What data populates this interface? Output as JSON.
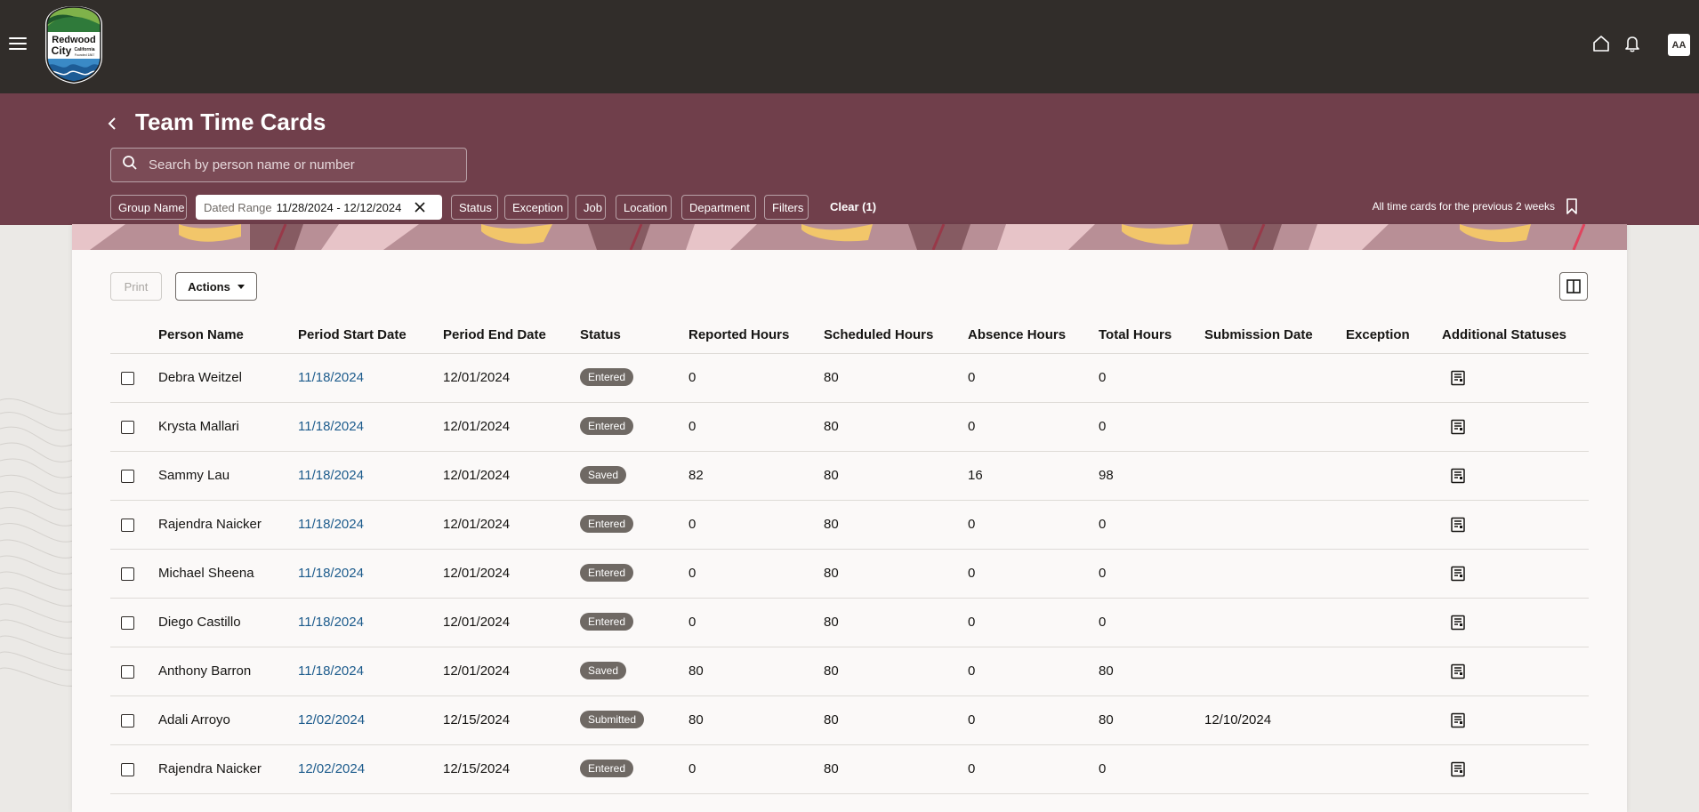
{
  "app": {
    "logo": {
      "line1": "Redwood",
      "line2": "City",
      "line3": "California",
      "line4": "Founded 1867"
    },
    "avatar_initials": "AA",
    "icons": [
      "menu-icon",
      "home-icon",
      "bell-icon"
    ]
  },
  "header": {
    "title": "Team Time Cards",
    "search_placeholder": "Search by person name or number",
    "chips": {
      "group_name": "Group Name",
      "dated_range_label": "Dated Range",
      "dated_range_value": "11/28/2024 - 12/12/2024",
      "status": "Status",
      "exception": "Exception",
      "job": "Job",
      "location": "Location",
      "department": "Department",
      "filters": "Filters",
      "clear": "Clear (1)"
    },
    "saved_search": "All time cards for the previous 2 weeks"
  },
  "toolbar": {
    "print": "Print",
    "actions": "Actions"
  },
  "table": {
    "columns": {
      "person_name": "Person Name",
      "period_start": "Period Start Date",
      "period_end": "Period End Date",
      "status": "Status",
      "reported": "Reported Hours",
      "scheduled": "Scheduled Hours",
      "absence": "Absence Hours",
      "total": "Total Hours",
      "submission": "Submission Date",
      "exception": "Exception",
      "additional": "Additional Statuses"
    },
    "rows": [
      {
        "name": "Debra Weitzel",
        "start": "11/18/2024",
        "end": "12/01/2024",
        "status": "Entered",
        "reported": "0",
        "scheduled": "80",
        "absence": "0",
        "total": "0",
        "submission": ""
      },
      {
        "name": "Krysta Mallari",
        "start": "11/18/2024",
        "end": "12/01/2024",
        "status": "Entered",
        "reported": "0",
        "scheduled": "80",
        "absence": "0",
        "total": "0",
        "submission": ""
      },
      {
        "name": "Sammy Lau",
        "start": "11/18/2024",
        "end": "12/01/2024",
        "status": "Saved",
        "reported": "82",
        "scheduled": "80",
        "absence": "16",
        "total": "98",
        "submission": ""
      },
      {
        "name": "Rajendra Naicker",
        "start": "11/18/2024",
        "end": "12/01/2024",
        "status": "Entered",
        "reported": "0",
        "scheduled": "80",
        "absence": "0",
        "total": "0",
        "submission": ""
      },
      {
        "name": "Michael Sheena",
        "start": "11/18/2024",
        "end": "12/01/2024",
        "status": "Entered",
        "reported": "0",
        "scheduled": "80",
        "absence": "0",
        "total": "0",
        "submission": ""
      },
      {
        "name": "Diego Castillo",
        "start": "11/18/2024",
        "end": "12/01/2024",
        "status": "Entered",
        "reported": "0",
        "scheduled": "80",
        "absence": "0",
        "total": "0",
        "submission": ""
      },
      {
        "name": "Anthony Barron",
        "start": "11/18/2024",
        "end": "12/01/2024",
        "status": "Saved",
        "reported": "80",
        "scheduled": "80",
        "absence": "0",
        "total": "80",
        "submission": ""
      },
      {
        "name": "Adali Arroyo",
        "start": "12/02/2024",
        "end": "12/15/2024",
        "status": "Submitted",
        "reported": "80",
        "scheduled": "80",
        "absence": "0",
        "total": "80",
        "submission": "12/10/2024"
      },
      {
        "name": "Rajendra Naicker",
        "start": "12/02/2024",
        "end": "12/15/2024",
        "status": "Entered",
        "reported": "0",
        "scheduled": "80",
        "absence": "0",
        "total": "0",
        "submission": ""
      }
    ]
  },
  "colors": {
    "appbar": "#312d2a",
    "header": "#703f4b",
    "link": "#1c5b8c",
    "badge": "#6f6964"
  }
}
